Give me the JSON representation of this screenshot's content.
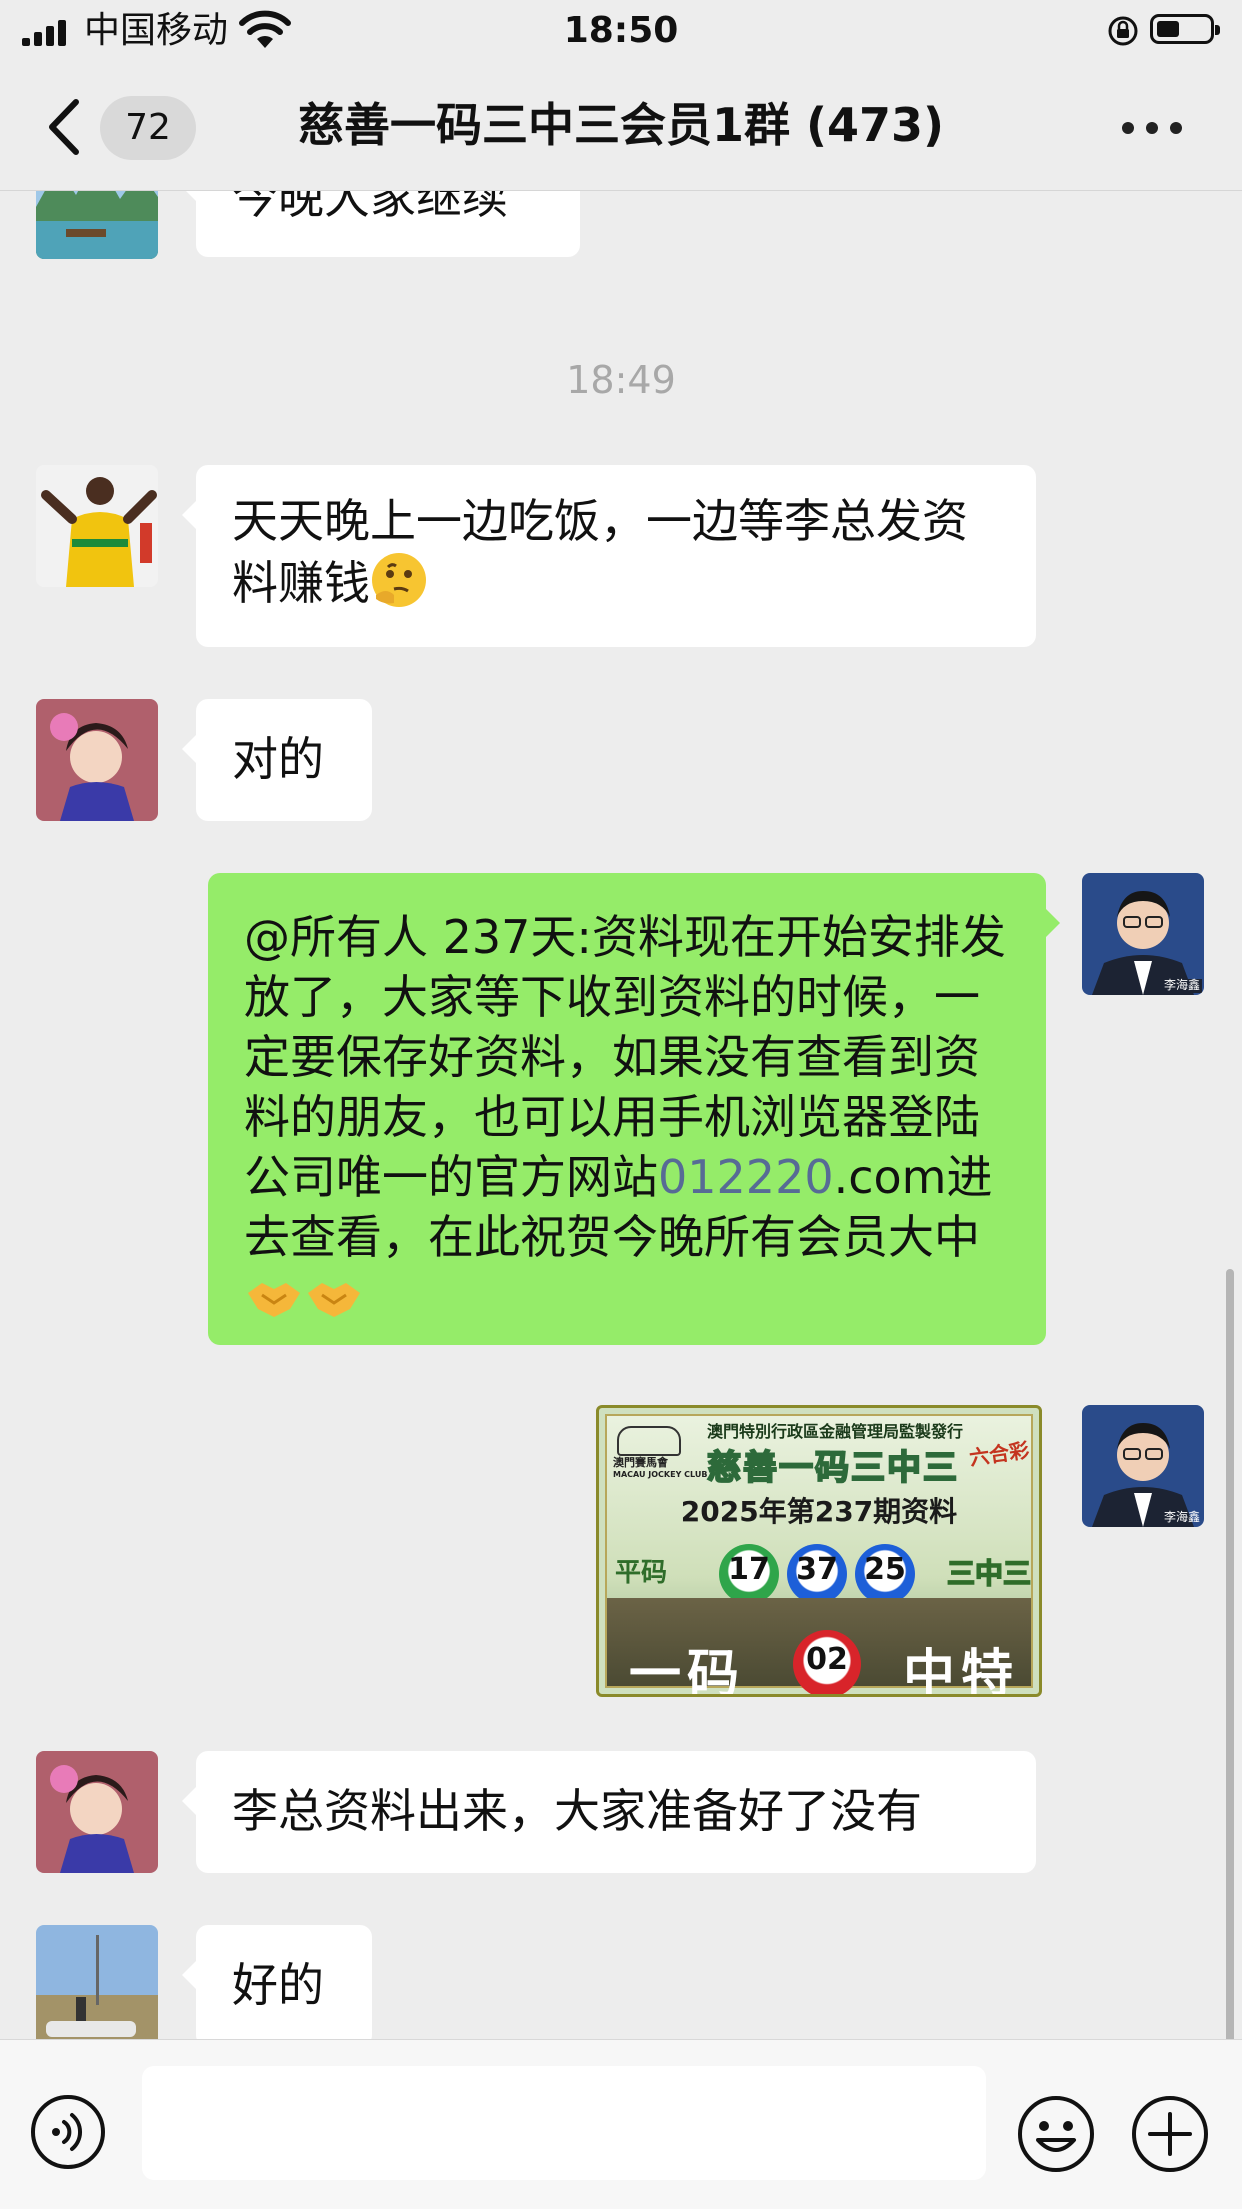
{
  "status_bar": {
    "carrier": "中国移动",
    "time": "18:50"
  },
  "nav": {
    "unread_count": "72",
    "title": "慈善一码三中三会员1群 (473)"
  },
  "messages": [
    {
      "side": "in",
      "avatar": "landscape-avatar",
      "text": "今晚大家继续"
    },
    {
      "type": "time",
      "text": "18:49"
    },
    {
      "side": "in",
      "avatar": "athlete-avatar",
      "text": "天天晚上一边吃饭，一边等李总发资料赚钱",
      "emoji": "thinking-face"
    },
    {
      "side": "in",
      "avatar": "woman-avatar",
      "text": "对的"
    },
    {
      "side": "out",
      "avatar": "man-suit-avatar",
      "avatar_label": "李海鑫",
      "text_a": "@所有人 237天:资料现在开始安排发放了，大家等下收到资料的时候，一定要保存好资料，如果没有查看到资料的朋友，也可以用手机浏览器登陆公司唯一的官方网站",
      "link": "012220",
      "text_b": ".com进去查看，在此祝贺今晚所有会员大中",
      "emoji": "handshake"
    },
    {
      "side": "out",
      "type": "image",
      "avatar": "man-suit-avatar",
      "avatar_label": "李海鑫",
      "image": {
        "header": "澳門特別行政區金融管理局監製發行",
        "club_cn": "澳門賽馬會",
        "club_en": "MACAU JOCKEY CLUB",
        "title": "慈善一码三中三",
        "badge": "六合彩",
        "period": "2025年第237期资料",
        "pingma_label": "平码",
        "balls": [
          "17",
          "37",
          "25"
        ],
        "ball_colors": [
          "#2fa54a",
          "#1d5fd8",
          "#1d5fd8"
        ],
        "sanzhong_label": "三中三",
        "yima_label": "一码",
        "special_ball": "02",
        "special_color": "#d8242a",
        "zhongte_label": "中特"
      }
    },
    {
      "side": "in",
      "avatar": "woman-avatar",
      "text": "李总资料出来，大家准备好了没有"
    },
    {
      "side": "in",
      "avatar": "field-avatar",
      "text": "好的"
    }
  ],
  "input_bar": {
    "placeholder": ""
  },
  "colors": {
    "background": "#ededed",
    "outgoing_bubble": "#95ec69",
    "incoming_bubble": "#ffffff",
    "link": "#576b95"
  }
}
